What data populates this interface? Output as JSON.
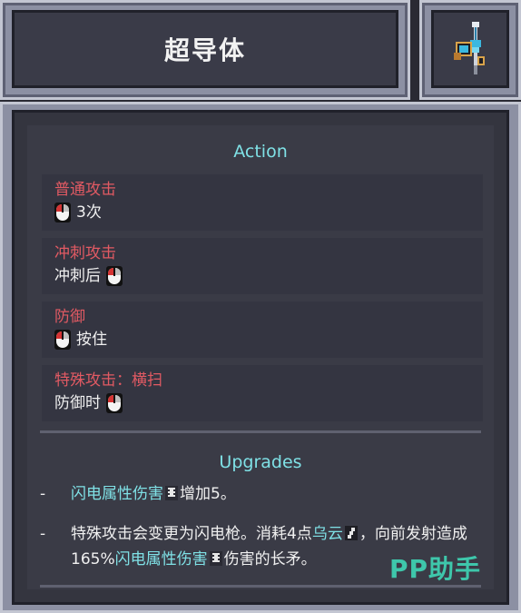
{
  "header": {
    "title": "超导体",
    "weapon_icon": "lightning-spear-icon"
  },
  "action": {
    "section_title": "Action",
    "items": [
      {
        "name": "普通攻击",
        "desc_before": "",
        "desc_after": "3次",
        "mouse_position": "before"
      },
      {
        "name": "冲刺攻击",
        "desc_before": "冲刺后",
        "desc_after": "",
        "mouse_position": "after"
      },
      {
        "name": "防御",
        "desc_before": "",
        "desc_after": "按住",
        "mouse_position": "before"
      },
      {
        "name": "特殊攻击：横扫",
        "desc_before": "防御时",
        "desc_after": "",
        "mouse_position": "after"
      }
    ]
  },
  "upgrades": {
    "section_title": "Upgrades",
    "items": [
      {
        "dash": "-",
        "part1_highlight": "闪电属性伤害",
        "part2": "增加5。"
      },
      {
        "dash": "-",
        "part1": "特殊攻击会变更为闪电枪。消耗4点",
        "part2_highlight": "乌云",
        "part3": "，向前发射造成165%",
        "part4_highlight": "闪电属性伤害",
        "part5": "伤害的长矛。"
      }
    ]
  },
  "watermark": "PP助手",
  "colors": {
    "accent_cyan": "#7fe1e6",
    "action_red": "#e25a63",
    "panel_bg": "#3a3b46"
  }
}
